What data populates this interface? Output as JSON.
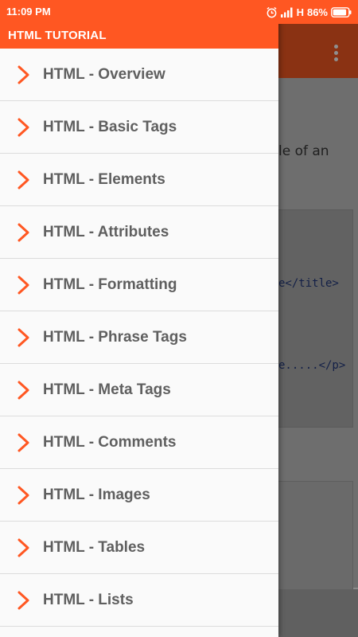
{
  "status_bar": {
    "time": "11:09 PM",
    "network": "H",
    "battery": "86%",
    "icons": [
      "alarm-icon",
      "signal-icon",
      "battery-icon"
    ]
  },
  "drawer": {
    "title": "HTML TUTORIAL",
    "accent_color": "#ff5722",
    "chevron_color": "#ff5722",
    "items": [
      {
        "label": "HTML - Overview"
      },
      {
        "label": "HTML - Basic Tags"
      },
      {
        "label": "HTML - Elements"
      },
      {
        "label": "HTML - Attributes"
      },
      {
        "label": "HTML - Formatting"
      },
      {
        "label": "HTML - Phrase Tags"
      },
      {
        "label": "HTML - Meta Tags"
      },
      {
        "label": "HTML - Comments"
      },
      {
        "label": "HTML - Images"
      },
      {
        "label": "HTML - Tables"
      },
      {
        "label": "HTML - Lists"
      }
    ]
  },
  "background_page": {
    "more_icon": "more-vert-icon",
    "text_fragment": "le of an",
    "code_lines": [
      "e</title>",
      "e.....</p>"
    ]
  }
}
